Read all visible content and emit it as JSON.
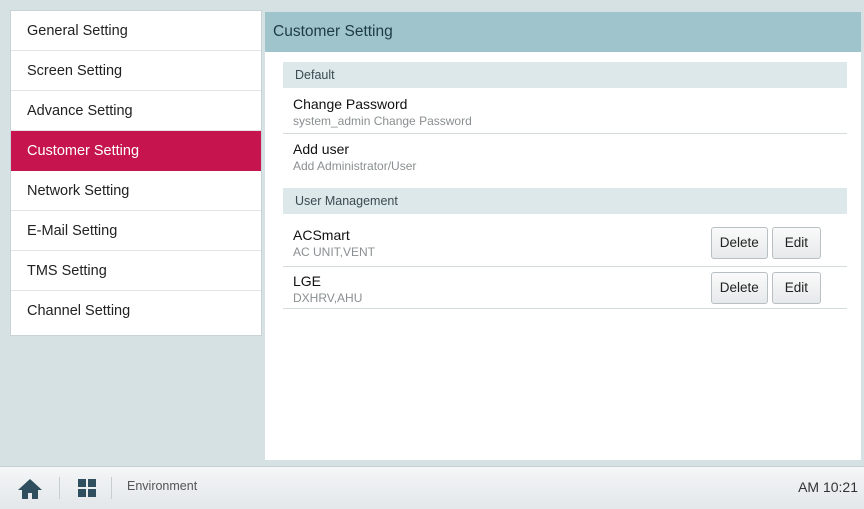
{
  "sidebar": {
    "items": [
      {
        "label": "General Setting"
      },
      {
        "label": "Screen Setting"
      },
      {
        "label": "Advance Setting"
      },
      {
        "label": "Customer Setting"
      },
      {
        "label": "Network Setting"
      },
      {
        "label": "E-Mail Setting"
      },
      {
        "label": "TMS Setting"
      },
      {
        "label": "Channel Setting"
      }
    ],
    "active_index": 3
  },
  "main": {
    "title": "Customer Setting",
    "default_section": {
      "label": "Default",
      "rows": [
        {
          "title": "Change Password",
          "subtitle": "system_admin Change Password"
        },
        {
          "title": "Add user",
          "subtitle": "Add Administrator/User"
        }
      ]
    },
    "user_section": {
      "label": "User Management",
      "users": [
        {
          "name": "ACSmart",
          "units": "AC UNIT,VENT",
          "delete_label": "Delete",
          "edit_label": "Edit"
        },
        {
          "name": "LGE",
          "units": "DXHRV,AHU",
          "delete_label": "Delete",
          "edit_label": "Edit"
        }
      ]
    }
  },
  "bottombar": {
    "home_icon": "home-icon",
    "apps_icon": "grid-icon",
    "breadcrumb": "Environment",
    "clock": "AM 10:21"
  },
  "colors": {
    "accent": "#c6154e",
    "header": "#9fc4cc",
    "section": "#dde8eb"
  }
}
